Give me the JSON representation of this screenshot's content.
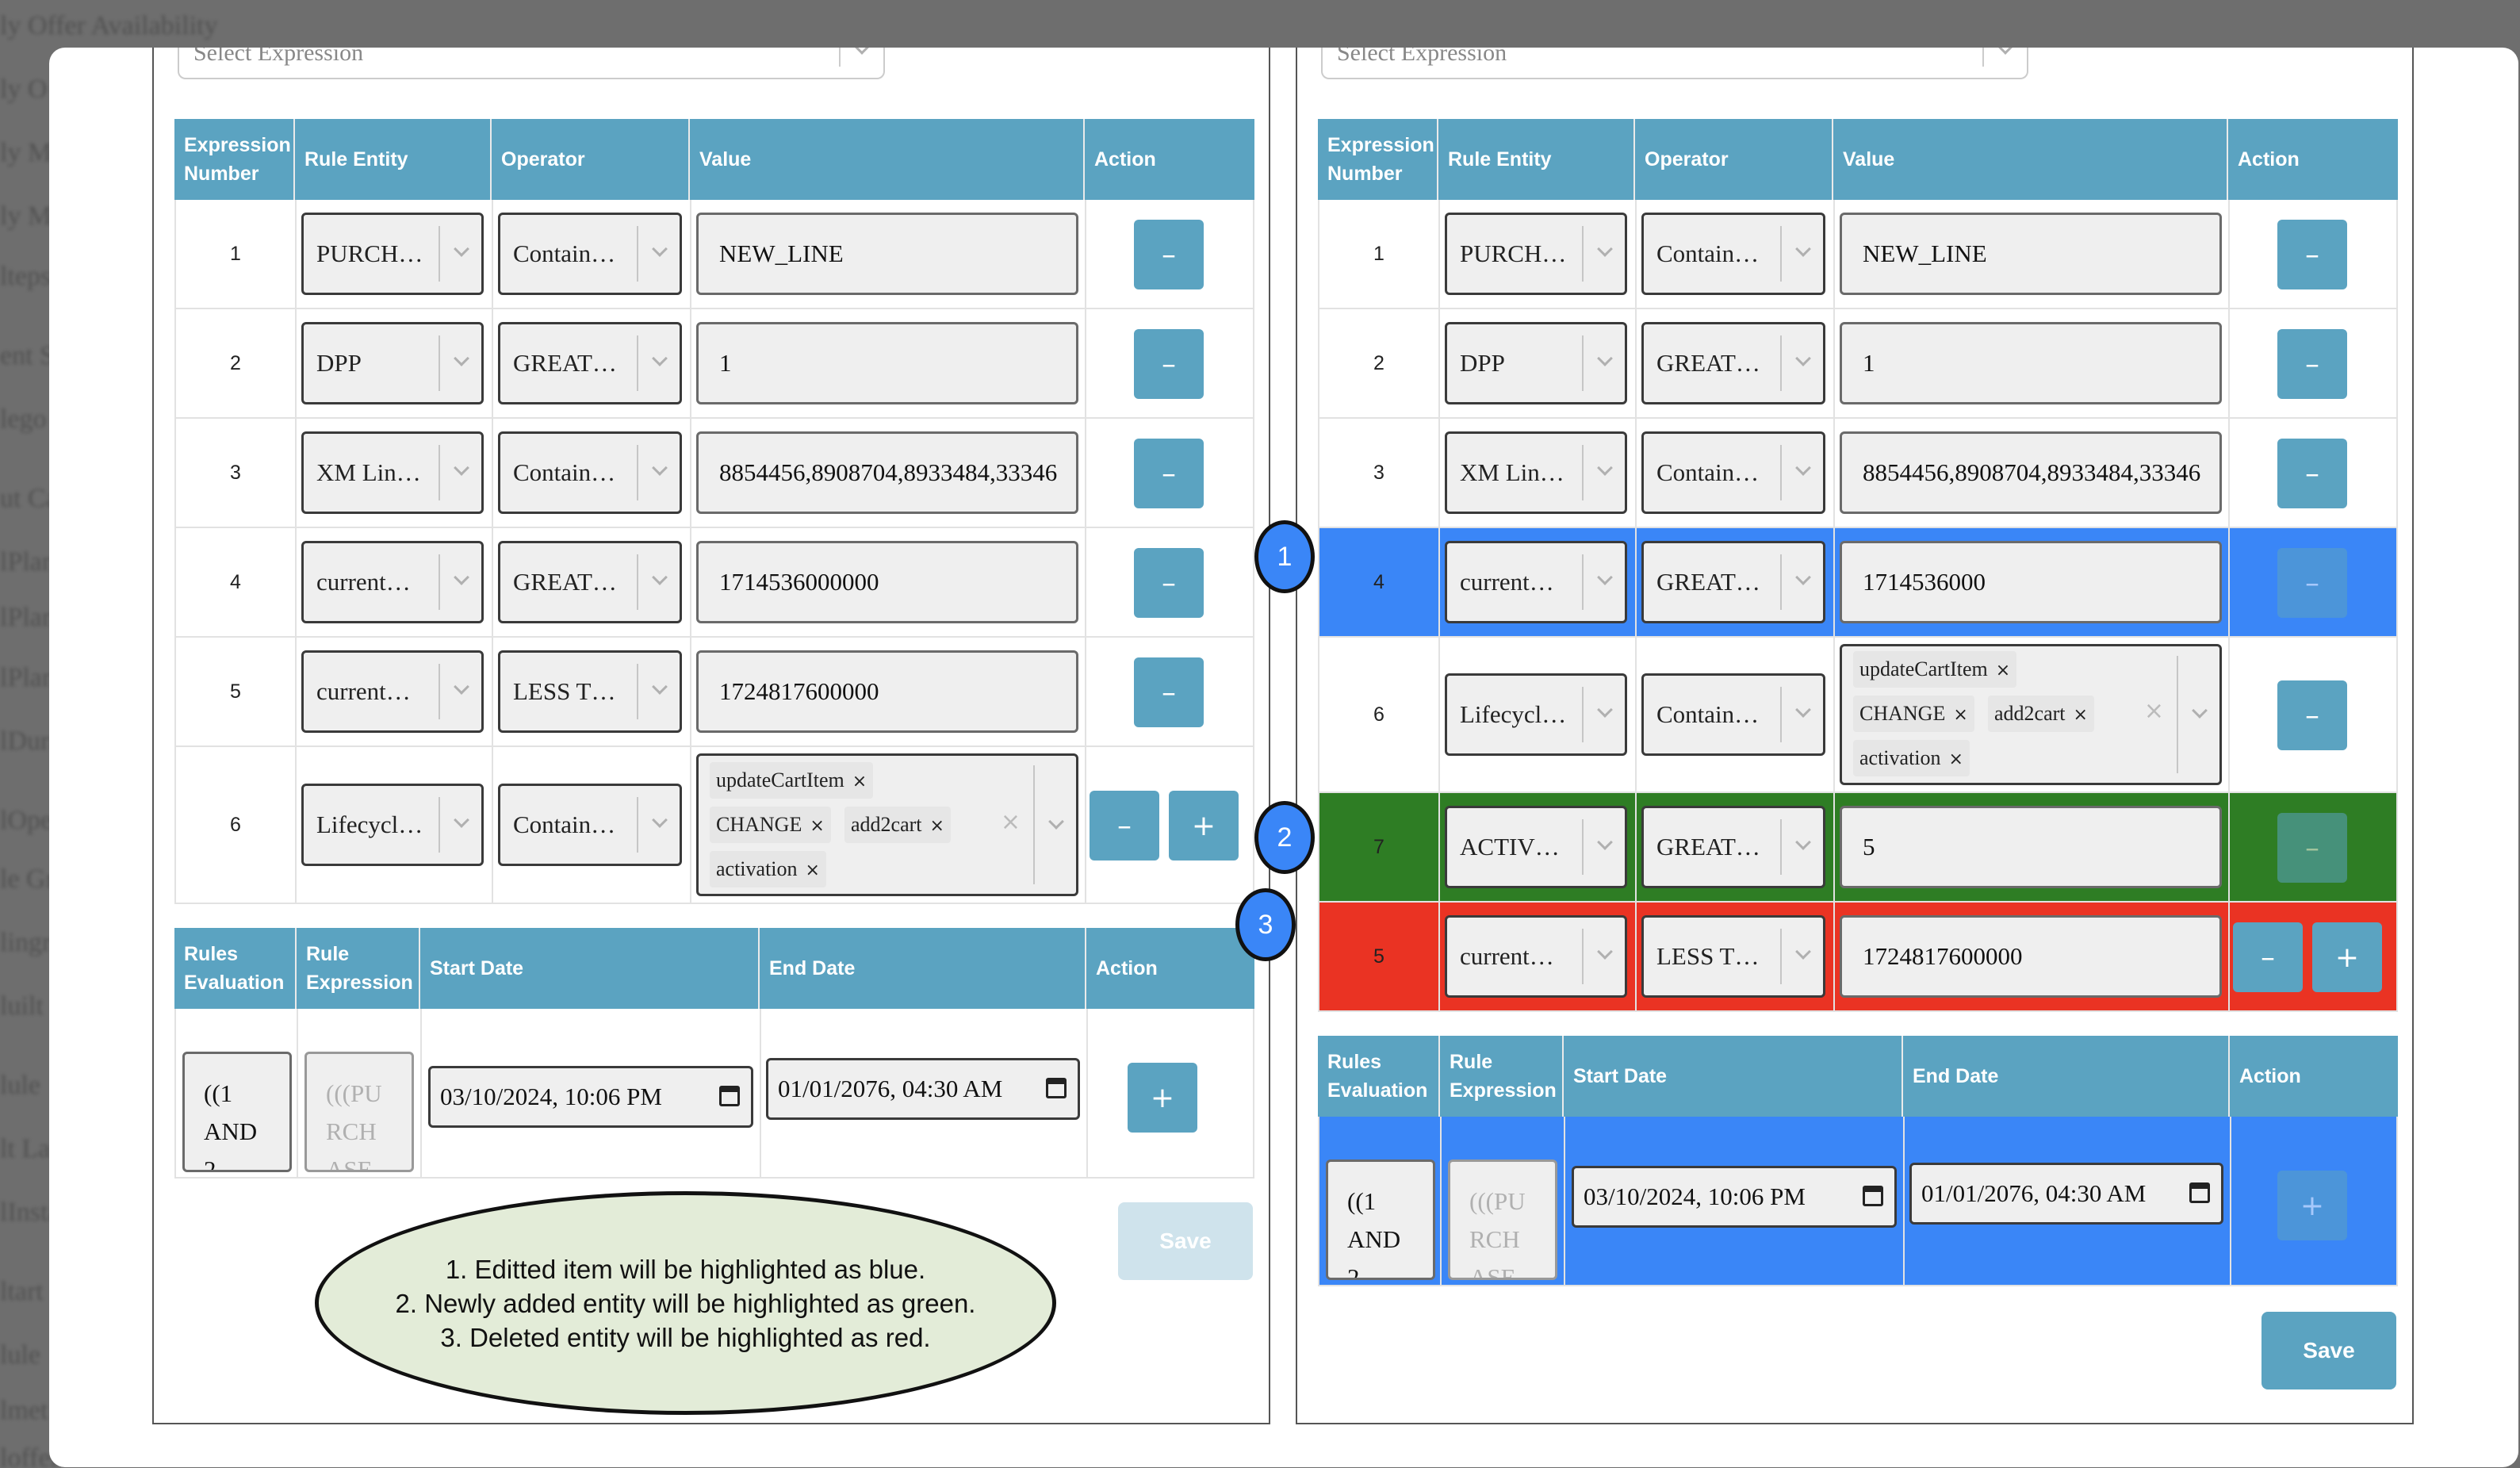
{
  "background": {
    "lines": [
      "ly Offer Availability",
      "ly O",
      "ly M",
      "ly M",
      "lteps",
      "ent S",
      "lego",
      "ut Ca",
      "lPlan",
      "lPlan",
      "lPlan",
      "lDurat",
      "lOper",
      "le Gro",
      "lingre",
      "luilt",
      "lule",
      "lt La",
      "lInsta",
      "ltart",
      "lule",
      "lmet",
      "loffer"
    ]
  },
  "left": {
    "select_placeholder": "Select Expression",
    "headers": {
      "expr_number": "Expression Number",
      "rule_entity": "Rule Entity",
      "operator": "Operator",
      "value": "Value",
      "action": "Action"
    },
    "rows": [
      {
        "num": "1",
        "entity": "PURCH…",
        "operator": "Contain…",
        "value": "NEW_LINE"
      },
      {
        "num": "2",
        "entity": "DPP",
        "operator": "GREAT…",
        "value": "1"
      },
      {
        "num": "3",
        "entity": "XM Lin…",
        "operator": "Contain…",
        "value": "8854456,8908704,8933484,33346"
      },
      {
        "num": "4",
        "entity": "current…",
        "operator": "GREAT…",
        "value": "1714536000000"
      },
      {
        "num": "5",
        "entity": "current…",
        "operator": "LESS T…",
        "value": "1724817600000"
      }
    ],
    "row6": {
      "num": "6",
      "entity": "Lifecycl…",
      "operator": "Contain…",
      "tags": [
        "updateCartItem",
        "CHANGE",
        "add2cart",
        "activation"
      ]
    },
    "rules_headers": {
      "rules_eval": "Rules Evaluation",
      "rule_expr": "Rule Expression",
      "start": "Start Date",
      "end": "End Date",
      "action": "Action"
    },
    "rules": {
      "eval": "((1 AND 2",
      "expr": "(((PU RCH ASE",
      "start": "03/10/2024, 10:06 PM",
      "end": "01/01/2076, 04:30 AM"
    },
    "save": "Save"
  },
  "right": {
    "select_placeholder": "Select Expression",
    "headers": {
      "expr_number": "Expression Number",
      "rule_entity": "Rule Entity",
      "operator": "Operator",
      "value": "Value",
      "action": "Action"
    },
    "rows": [
      {
        "num": "1",
        "entity": "PURCH…",
        "operator": "Contain…",
        "value": "NEW_LINE"
      },
      {
        "num": "2",
        "entity": "DPP",
        "operator": "GREAT…",
        "value": "1"
      },
      {
        "num": "3",
        "entity": "XM Lin…",
        "operator": "Contain…",
        "value": "8854456,8908704,8933484,33346"
      },
      {
        "num": "4",
        "entity": "current…",
        "operator": "GREAT…",
        "value": "1714536000"
      }
    ],
    "row6": {
      "num": "6",
      "entity": "Lifecycl…",
      "operator": "Contain…",
      "tags": [
        "updateCartItem",
        "CHANGE",
        "add2cart",
        "activation"
      ]
    },
    "row7": {
      "num": "7",
      "entity": "ACTIV…",
      "operator": "GREAT…",
      "value": "5"
    },
    "row5": {
      "num": "5",
      "entity": "current…",
      "operator": "LESS T…",
      "value": "1724817600000"
    },
    "rules_headers": {
      "rules_eval": "Rules Evaluation",
      "rule_expr": "Rule Expression",
      "start": "Start Date",
      "end": "End Date",
      "action": "Action"
    },
    "rules": {
      "eval": "((1 AND 2",
      "expr": "(((PU RCH ASE",
      "start": "03/10/2024, 10:06 PM",
      "end": "01/01/2076, 04:30 AM"
    },
    "save": "Save"
  },
  "buttons": {
    "minus": "–",
    "plus": "+",
    "tag_remove": "×",
    "clear": "×"
  },
  "markers": [
    "1",
    "2",
    "3"
  ],
  "legend": [
    "1. Editted item will be highlighted as blue.",
    "2. Newly added entity will be highlighted as green.",
    "3. Deleted entity will be highlighted as red."
  ],
  "colors": {
    "header": "#5ba3c1",
    "edited": "#3a86f7",
    "added": "#2e7d24",
    "deleted": "#ea3323"
  }
}
